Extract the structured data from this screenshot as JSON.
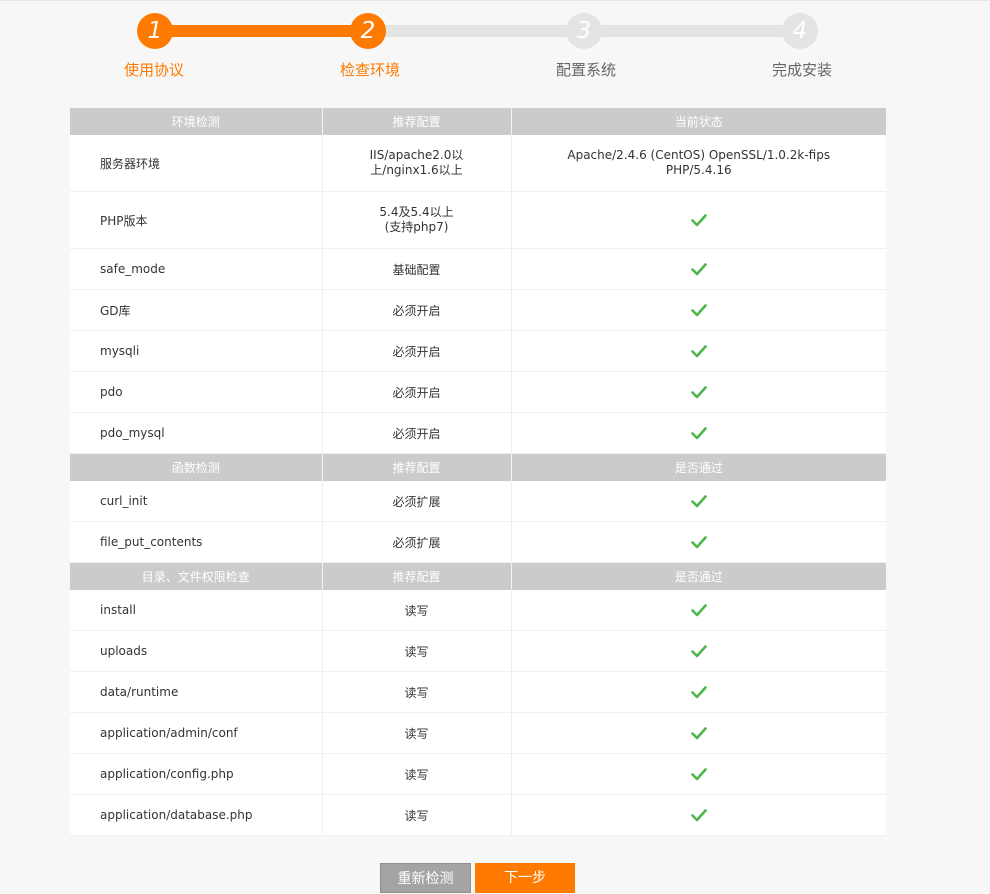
{
  "steps": [
    {
      "number": "1",
      "label": "使用协议",
      "state": "done"
    },
    {
      "number": "2",
      "label": "检查环境",
      "state": "current"
    },
    {
      "number": "3",
      "label": "配置系统",
      "state": "pending"
    },
    {
      "number": "4",
      "label": "完成安装",
      "state": "pending"
    }
  ],
  "colors": {
    "accent": "#ff7a00",
    "header_bg": "#cbcbcb",
    "inactive": "#e4e4e4",
    "check": "#4cb84c"
  },
  "env_section": {
    "headers": [
      "环境检测",
      "推荐配置",
      "当前状态"
    ],
    "rows": [
      {
        "name": "服务器环境",
        "recommended": "IIS/apache2.0以\n上/nginx1.6以上",
        "status": "Apache/2.4.6 (CentOS) OpenSSL/1.0.2k-fips\nPHP/5.4.16"
      },
      {
        "name": "PHP版本",
        "recommended": "5.4及5.4以上\n(支持php7)",
        "status": "check-icon"
      },
      {
        "name": "safe_mode",
        "recommended": "基础配置",
        "status": "check-icon"
      },
      {
        "name": "GD库",
        "recommended": "必须开启",
        "status": "check-icon"
      },
      {
        "name": "mysqli",
        "recommended": "必须开启",
        "status": "check-icon"
      },
      {
        "name": "pdo",
        "recommended": "必须开启",
        "status": "check-icon"
      },
      {
        "name": "pdo_mysql",
        "recommended": "必须开启",
        "status": "check-icon"
      }
    ]
  },
  "func_section": {
    "headers": [
      "函数检测",
      "推荐配置",
      "是否通过"
    ],
    "rows": [
      {
        "name": "curl_init",
        "recommended": "必须扩展",
        "status": "check-icon"
      },
      {
        "name": "file_put_contents",
        "recommended": "必须扩展",
        "status": "check-icon"
      }
    ]
  },
  "dir_section": {
    "headers": [
      "目录、文件权限检查",
      "推荐配置",
      "是否通过"
    ],
    "rows": [
      {
        "name": "install",
        "recommended": "读写",
        "status": "check-icon"
      },
      {
        "name": "uploads",
        "recommended": "读写",
        "status": "check-icon"
      },
      {
        "name": "data/runtime",
        "recommended": "读写",
        "status": "check-icon"
      },
      {
        "name": "application/admin/conf",
        "recommended": "读写",
        "status": "check-icon"
      },
      {
        "name": "application/config.php",
        "recommended": "读写",
        "status": "check-icon"
      },
      {
        "name": "application/database.php",
        "recommended": "读写",
        "status": "check-icon"
      }
    ]
  },
  "buttons": {
    "recheck": "重新检测",
    "next": "下一步"
  }
}
